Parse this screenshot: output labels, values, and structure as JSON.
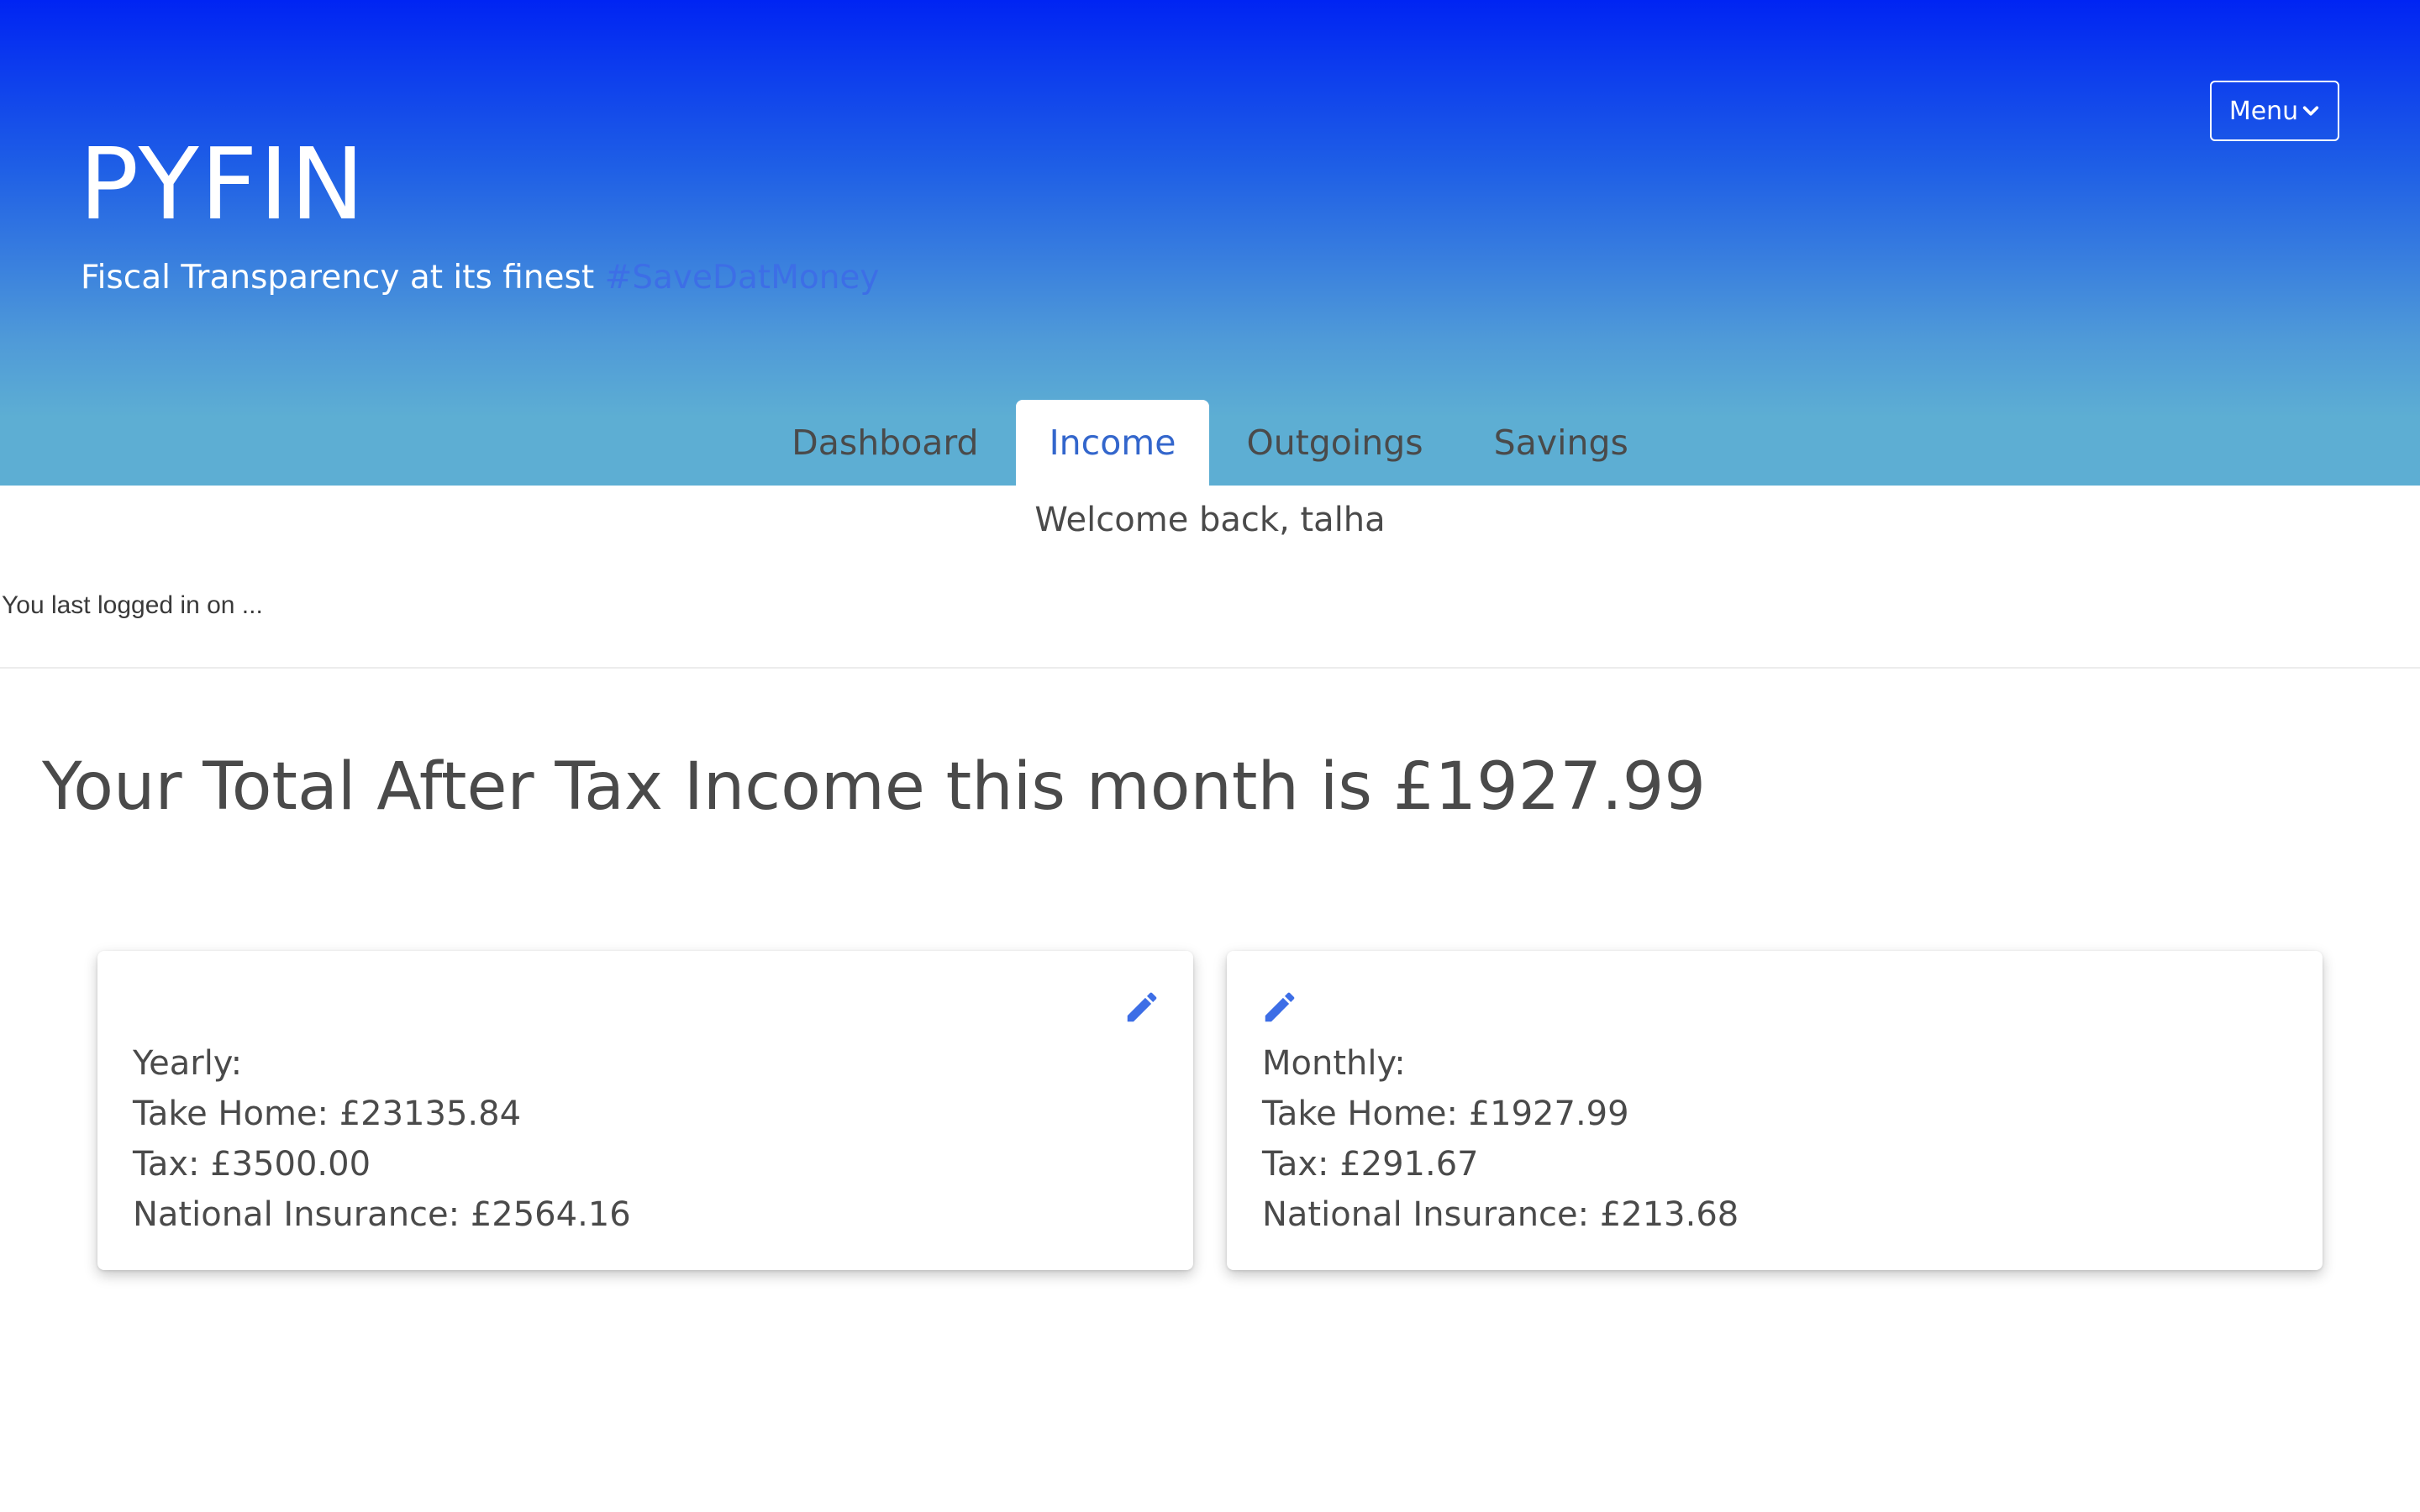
{
  "header": {
    "menu_label": "Menu",
    "brand_title": "PYFIN",
    "subtitle": "Fiscal Transparency at its finest",
    "hashtag": "#SaveDatMoney"
  },
  "tabs": [
    {
      "label": "Dashboard",
      "active": false
    },
    {
      "label": "Income",
      "active": true
    },
    {
      "label": "Outgoings",
      "active": false
    },
    {
      "label": "Savings",
      "active": false
    }
  ],
  "welcome": "Welcome back, talha",
  "last_login": "You last logged in on ...",
  "total_heading": "Your Total After Tax Income this month is £1927.99",
  "cards": {
    "yearly": {
      "title": "Yearly:",
      "take_home": "Take Home: £23135.84",
      "tax": "Tax: £3500.00",
      "national_insurance": "National Insurance: £2564.16"
    },
    "monthly": {
      "title": "Monthly:",
      "take_home": "Take Home: £1927.99",
      "tax": "Tax: £291.67",
      "national_insurance": "National Insurance: £213.68"
    }
  },
  "icons": {
    "menu": "chevron-down-icon",
    "edit": "pencil-icon"
  },
  "colors": {
    "gradient_top": "#0024f3",
    "gradient_bottom": "#5daed3",
    "accent": "#3366cc",
    "hashtag": "#3d6ee6"
  }
}
